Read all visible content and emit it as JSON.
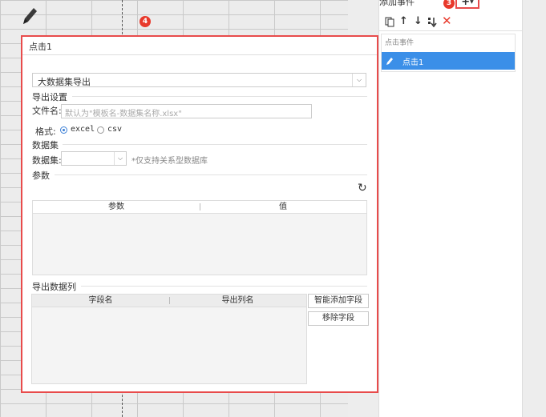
{
  "canvas": {
    "badge_number": "4"
  },
  "right_panel": {
    "add_event_label": "添加事件",
    "add_badge_number": "3",
    "add_button_label": "+",
    "list_header": "点击事件",
    "event_item_label": "点击1"
  },
  "dialog": {
    "title": "点击1",
    "action_select_value": "大数据集导出",
    "export_settings_title": "导出设置",
    "filename_label": "文件名:",
    "filename_placeholder": "默认为\"模板名-数据集名称.xlsx\"",
    "format_label": "格式:",
    "format_options": [
      "excel",
      "csv"
    ],
    "dataset_section_title": "数据集",
    "dataset_label": "数据集:",
    "dataset_note": "*仅支持关系型数据库",
    "params_title": "参数",
    "params_table_headers": [
      "参数",
      "值"
    ],
    "export_columns_title": "导出数据列",
    "columns_table_headers": [
      "字段名",
      "导出列名"
    ],
    "smart_add_button": "智能添加字段",
    "remove_field_button": "移除字段"
  },
  "colors": {
    "accent": "#e84b4b",
    "selected": "#3b8fe8",
    "delete": "#e8392b"
  }
}
